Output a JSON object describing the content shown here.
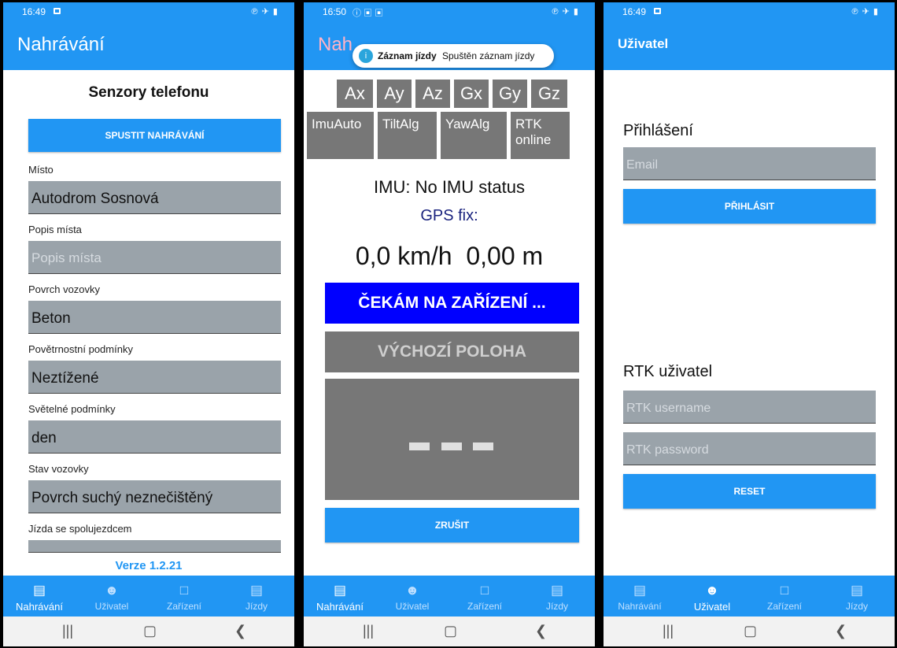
{
  "status_bar": {
    "p1_time": "16:49",
    "p2_time": "16:50",
    "p3_time": "16:49"
  },
  "nav": {
    "recording": "Nahrávání",
    "user": "Uživatel",
    "devices": "Zařízení",
    "rides": "Jízdy"
  },
  "phone1": {
    "title": "Nahrávání",
    "heading": "Senzory telefonu",
    "start_button": "SPUSTIT NAHRÁVÁNÍ",
    "fields": [
      {
        "label": "Místo",
        "value": "Autodrom Sosnová"
      },
      {
        "label": "Popis místa",
        "placeholder": "Popis místa"
      },
      {
        "label": "Povrch vozovky",
        "value": "Beton"
      },
      {
        "label": "Povětrnostní podmínky",
        "value": "Neztížené"
      },
      {
        "label": "Světelné podmínky",
        "value": "den"
      },
      {
        "label": "Stav vozovky",
        "value": "Povrch suchý neznečištěný"
      },
      {
        "label": "Jízda se spolujezdcem",
        "value": ""
      }
    ],
    "version": "Verze 1.2.21"
  },
  "phone2": {
    "title_partial": "Nah",
    "toast_title": "Záznam jízdy",
    "toast_message": "Spuštěn záznam jízdy",
    "sensors": [
      "Ax",
      "Ay",
      "Az",
      "Gx",
      "Gy",
      "Gz"
    ],
    "status_tiles": [
      "ImuAuto",
      "TiltAlg",
      "YawAlg",
      "RTK online"
    ],
    "imu_status": "IMU: No IMU status",
    "gps_fix": "GPS fix:",
    "speed": "0,0 km/h",
    "distance": "0,00 m",
    "waiting_button": "ČEKÁM NA ZAŘÍZENÍ ...",
    "home_button": "VÝCHOZÍ POLOHA",
    "cancel_button": "ZRUŠIT"
  },
  "phone3": {
    "title": "Uživatel",
    "login_heading": "Přihlášení",
    "email_placeholder": "Email",
    "login_button": "PŘIHLÁSIT",
    "rtk_heading": "RTK uživatel",
    "rtk_username_placeholder": "RTK username",
    "rtk_password_placeholder": "RTK password",
    "reset_button": "RESET"
  },
  "colors": {
    "primary": "#2196f3",
    "field_bg": "#9aa3aa",
    "tile_bg": "#777777",
    "waiting_bg": "#0000ff",
    "version_text": "#2196f3"
  },
  "icons": {
    "nav_recording": "list-icon",
    "nav_user": "person-icon",
    "nav_devices": "device-icon",
    "nav_rides": "list-icon"
  }
}
